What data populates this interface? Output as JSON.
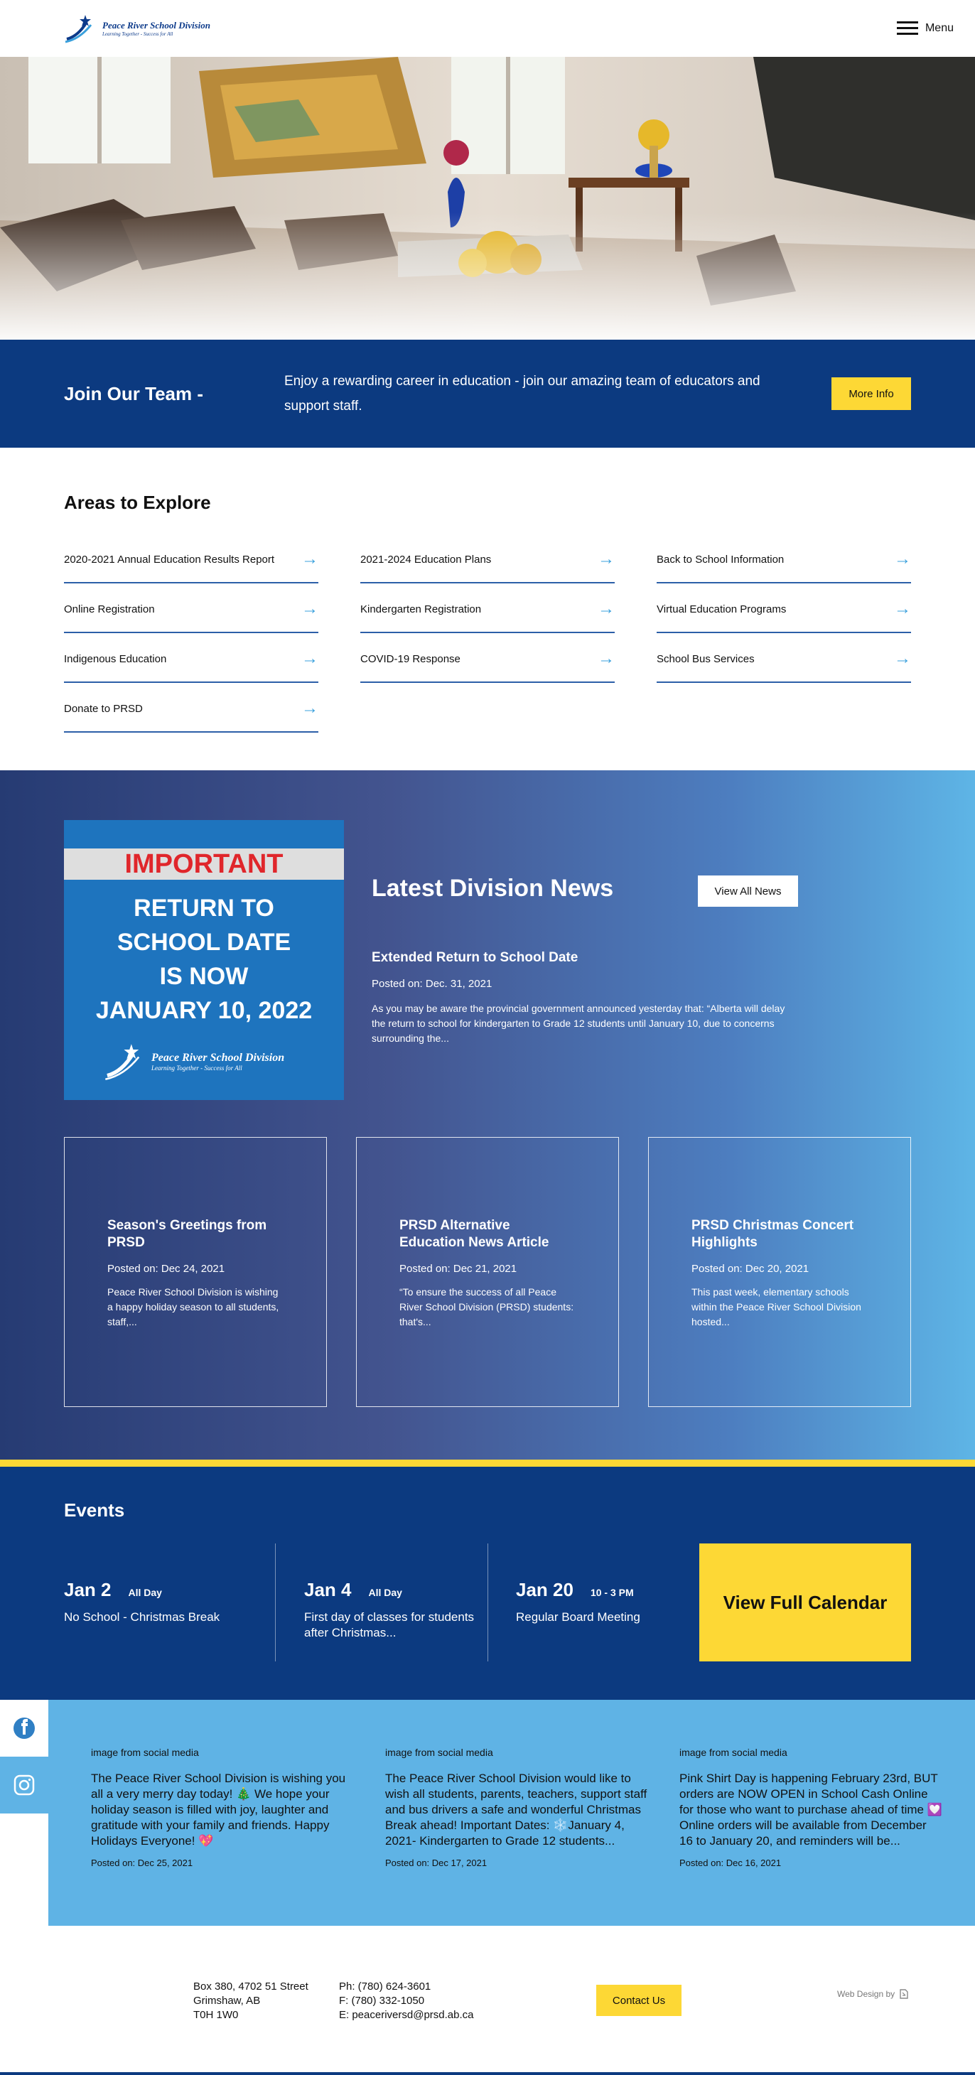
{
  "header": {
    "logo_title": "Peace River School Division",
    "logo_tagline": "Learning Together - Success for All",
    "menu_label": "Menu"
  },
  "join": {
    "title": "Join Our Team -",
    "text": "Enjoy a rewarding career in education - join our amazing team of educators and support staff.",
    "button": "More Info"
  },
  "areas": {
    "title": "Areas to Explore",
    "items": [
      "2020-2021 Annual Education Results Report",
      "2021-2024 Education Plans",
      "Back to School Information",
      "Online Registration",
      "Kindergarten Registration",
      "Virtual Education Programs",
      "Indigenous Education",
      "COVID-19 Response",
      "School Bus Services",
      "Donate to PRSD"
    ]
  },
  "news": {
    "featured_image": {
      "band": "IMPORTANT",
      "line1": "RETURN TO",
      "line2": "SCHOOL DATE",
      "line3": "IS NOW",
      "line4": "JANUARY 10, 2022",
      "logo_title": "Peace River School Division",
      "logo_tagline": "Learning Together - Success for All"
    },
    "title": "Latest Division News",
    "view_all": "View All News",
    "featured": {
      "headline": "Extended Return to School Date",
      "date": "Posted on: Dec. 31, 2021",
      "excerpt": "As you may be aware the provincial government announced yesterday that: “Alberta will delay the return to school for kindergarten to Grade 12 students until January 10, due to concerns surrounding the..."
    },
    "cards": [
      {
        "title": "Season's Greetings from PRSD",
        "date": "Posted on: Dec 24, 2021",
        "excerpt": "Peace River School Division is wishing a happy holiday season to all students, staff,..."
      },
      {
        "title": "PRSD Alternative Education News Article",
        "date": "Posted on: Dec 21, 2021",
        "excerpt": "“To ensure the success of all Peace River School Division (PRSD) students: that's..."
      },
      {
        "title": "PRSD Christmas Concert Highlights",
        "date": "Posted on: Dec 20, 2021",
        "excerpt": "This past week, elementary schools within the Peace River School Division hosted..."
      }
    ]
  },
  "events": {
    "title": "Events",
    "items": [
      {
        "date": "Jan 2",
        "time": "All Day",
        "title": "No School - Christmas Break"
      },
      {
        "date": "Jan 4",
        "time": "All Day",
        "title": "First day of classes for students after Christmas..."
      },
      {
        "date": "Jan 20",
        "time": "10 - 3 PM",
        "title": "Regular Board Meeting"
      }
    ],
    "calendar_button": "View Full Calendar"
  },
  "social": {
    "icons": [
      "facebook-icon",
      "instagram-icon"
    ],
    "posts": [
      {
        "source": "image from social media",
        "text": "The Peace River School Division is wishing you all a very merry day today! 🎄 We hope your holiday season is filled with joy, laughter and gratitude with your family and friends. Happy Holidays Everyone! 💖",
        "date": "Posted on: Dec 25, 2021"
      },
      {
        "source": "image from social media",
        "text": "The Peace River School Division would like to wish all students, parents, teachers, support staff and bus drivers a safe and wonderful Christmas Break ahead! Important Dates: ❄️January 4, 2021- Kindergarten to Grade 12 students...",
        "date": "Posted on: Dec 17, 2021"
      },
      {
        "source": "image from social media",
        "text": "Pink Shirt Day is happening February 23rd, BUT orders are NOW OPEN in School Cash Online for those who want to purchase ahead of time 💟Online orders will be available from December 16 to January 20, and reminders will be...",
        "date": "Posted on: Dec 16, 2021"
      }
    ]
  },
  "footer": {
    "address_line1": "Box 380, 4702 51 Street",
    "address_line2": "Grimshaw, AB",
    "address_line3": "T0H 1W0",
    "phone": "Ph: (780) 624-3601",
    "fax": "F: (780) 332-1050",
    "email": "E: peaceriversd@prsd.ab.ca",
    "contact_button": "Contact Us",
    "credit": "Web Design by"
  },
  "colors": {
    "navy": "#0c3a80",
    "yellow": "#fdd835",
    "sky": "#5fb3e5",
    "accent_arrow": "#3aa0dc",
    "important_red": "#e0262b"
  }
}
